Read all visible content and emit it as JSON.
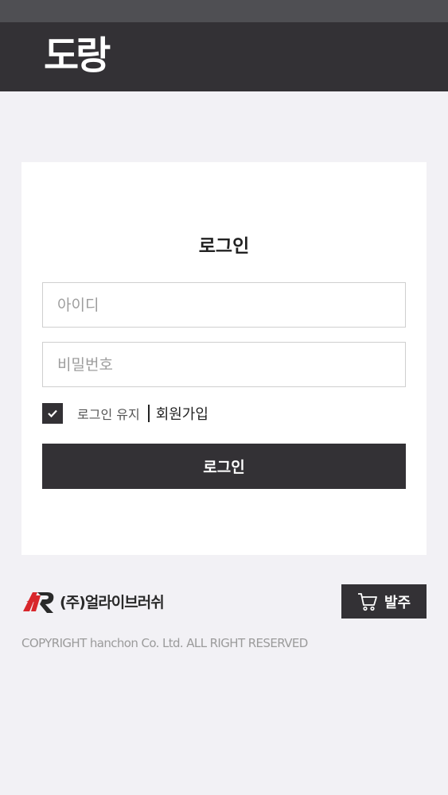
{
  "header": {
    "logo_text": "도랑"
  },
  "login": {
    "title": "로그인",
    "id_placeholder": "아이디",
    "password_placeholder": "비밀번호",
    "keep_login_label": "로그인 유지",
    "keep_login_checked": true,
    "signup_label": "회원가입",
    "submit_label": "로그인"
  },
  "footer": {
    "company_name": "(주)얼라이브러쉬",
    "order_label": "발주",
    "copyright": "COPYRIGHT hanchon Co. Ltd. ALL RIGHT RESERVED"
  },
  "colors": {
    "dark": "#333135",
    "background": "#f2f1f5",
    "logo_red": "#d8262b"
  }
}
